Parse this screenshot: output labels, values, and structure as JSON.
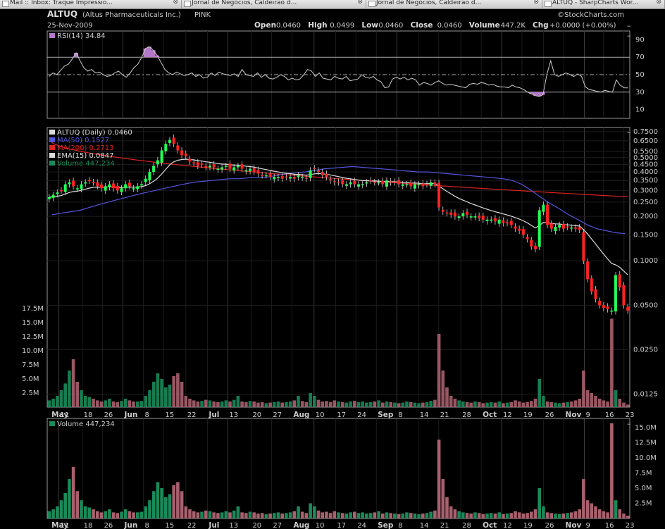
{
  "browser": {
    "tabs": [
      {
        "label": "Mail :: Inbox: Traque Impressio...",
        "x": 0,
        "w": 258
      },
      {
        "label": "Jornal de Negócios, Caldeirão d...",
        "x": 258,
        "w": 262
      },
      {
        "label": "Jornal de Negócios, Caldeirão d...",
        "x": 520,
        "w": 250
      },
      {
        "label": "ALTUQ - SharpCharts Wor...",
        "x": 770,
        "w": 174
      }
    ]
  },
  "header": {
    "symbol": "ALTUQ",
    "company": "(Altus Pharmaceuticals Inc.)",
    "exchange": "PINK",
    "date": "25-Nov-2009",
    "brand": "©StockCharts.com",
    "quote": [
      {
        "label": "Open",
        "value": "0.0460"
      },
      {
        "label": "High",
        "value": "0.0499"
      },
      {
        "label": "Low",
        "value": "0.0460"
      },
      {
        "label": "Close",
        "value": "0.0460"
      },
      {
        "label": "Volume",
        "value": "447.2K"
      },
      {
        "label": "Chg",
        "value": "+0.0000 (+0.00%)"
      }
    ]
  },
  "colors": {
    "up": "#22ff55",
    "down": "#ff2222",
    "vol_up": "#1a8a5a",
    "vol_down": "#a8606e",
    "ma50": "#5555dd",
    "ma200": "#dd2222",
    "ema": "#dddddd",
    "rsi": "#cccccc",
    "rsi_fill": "#b478c8",
    "grid": "#2a2a2a",
    "text": "#cccccc"
  },
  "chart_data": [
    {
      "type": "line",
      "title": "RSI(14) 34.84",
      "legend": "RSI(14) 34.84",
      "y_ticks": [
        90,
        70,
        50,
        30,
        10
      ],
      "ylim": [
        0,
        100
      ],
      "reference_lines": [
        70,
        50,
        30
      ],
      "series": [
        {
          "name": "RSI(14)",
          "values": [
            48,
            52,
            50,
            55,
            60,
            62,
            68,
            75,
            66,
            58,
            54,
            56,
            52,
            53,
            50,
            48,
            49,
            52,
            54,
            50,
            47,
            52,
            58,
            62,
            70,
            80,
            82,
            78,
            72,
            64,
            56,
            52,
            50,
            53,
            51,
            49,
            50,
            52,
            48,
            50,
            46,
            47,
            52,
            49,
            53,
            51,
            50,
            49,
            51,
            48,
            56,
            50,
            49,
            48,
            52,
            47,
            50,
            46,
            45,
            47,
            50,
            48,
            44,
            46,
            44,
            45,
            50,
            56,
            54,
            48,
            52,
            46,
            45,
            44,
            48,
            46,
            45,
            48,
            43,
            44,
            45,
            50,
            47,
            46,
            48,
            44,
            42,
            35,
            36,
            45,
            47,
            45,
            47,
            44,
            46,
            44,
            38,
            41,
            40,
            38,
            41,
            43,
            40,
            38,
            39,
            38,
            37,
            36,
            35,
            39,
            40,
            39,
            41,
            40,
            38,
            39,
            37,
            36,
            36,
            35,
            38,
            36,
            35,
            33,
            30,
            28,
            26,
            25,
            27,
            50,
            66,
            50,
            48,
            50,
            52,
            50,
            48,
            51,
            48,
            36,
            33,
            32,
            31,
            30,
            32,
            31,
            30,
            44,
            38,
            35,
            34.84
          ]
        }
      ]
    },
    {
      "type": "candlestick",
      "title": "ALTUQ (Daily) 0.0460",
      "legend": [
        {
          "label": "ALTUQ (Daily) 0.0460",
          "color": "#dddddd"
        },
        {
          "label": "MA(50) 0.1527",
          "color": "#5555dd"
        },
        {
          "label": "MA(200) 0.2713",
          "color": "#dd2222"
        },
        {
          "label": "EMA(15) 0.0847",
          "color": "#dddddd"
        },
        {
          "label": "Volume 447,234",
          "color": "#1a8a5a"
        }
      ],
      "y_scale": "log",
      "y_ticks": [
        "0.7500",
        "0.6500",
        "0.5500",
        "0.5000",
        "0.4500",
        "0.4000",
        "0.3500",
        "0.3000",
        "0.2500",
        "0.2000",
        "0.1500",
        "0.1000",
        "0.0500",
        "0.0250",
        "0.0125"
      ],
      "x_labels": [
        "May",
        "11",
        "18",
        "26",
        "Jun",
        "8",
        "15",
        "22",
        "Jul",
        "13",
        "20",
        "27",
        "Aug",
        "10",
        "17",
        "24",
        "Sep",
        "8",
        "14",
        "21",
        "28",
        "Oct",
        "12",
        "19",
        "26",
        "Nov",
        "9",
        "16",
        "23"
      ],
      "volume_overlay_ticks": [
        "17.5M",
        "15.0M",
        "12.5M",
        "10.0M",
        "7.5M",
        "5.0M",
        "2.5M"
      ],
      "close": [
        0.27,
        0.28,
        0.29,
        0.3,
        0.33,
        0.34,
        0.32,
        0.31,
        0.33,
        0.34,
        0.35,
        0.34,
        0.32,
        0.31,
        0.32,
        0.33,
        0.31,
        0.3,
        0.31,
        0.33,
        0.32,
        0.31,
        0.32,
        0.33,
        0.36,
        0.4,
        0.44,
        0.48,
        0.56,
        0.62,
        0.66,
        0.62,
        0.56,
        0.52,
        0.51,
        0.47,
        0.46,
        0.44,
        0.45,
        0.43,
        0.44,
        0.43,
        0.42,
        0.43,
        0.44,
        0.42,
        0.43,
        0.44,
        0.42,
        0.41,
        0.42,
        0.4,
        0.39,
        0.38,
        0.38,
        0.37,
        0.37,
        0.37,
        0.36,
        0.37,
        0.37,
        0.36,
        0.38,
        0.37,
        0.36,
        0.41,
        0.42,
        0.4,
        0.38,
        0.37,
        0.35,
        0.34,
        0.34,
        0.33,
        0.33,
        0.34,
        0.33,
        0.33,
        0.33,
        0.34,
        0.35,
        0.34,
        0.34,
        0.33,
        0.35,
        0.34,
        0.34,
        0.33,
        0.33,
        0.33,
        0.32,
        0.33,
        0.33,
        0.32,
        0.33,
        0.34,
        0.33,
        0.23,
        0.215,
        0.21,
        0.205,
        0.2,
        0.2,
        0.21,
        0.205,
        0.2,
        0.2,
        0.195,
        0.19,
        0.19,
        0.19,
        0.185,
        0.19,
        0.18,
        0.18,
        0.175,
        0.165,
        0.16,
        0.15,
        0.14,
        0.125,
        0.12,
        0.22,
        0.24,
        0.175,
        0.165,
        0.17,
        0.175,
        0.165,
        0.17,
        0.168,
        0.165,
        0.162,
        0.1,
        0.075,
        0.062,
        0.055,
        0.05,
        0.048,
        0.047,
        0.046,
        0.08,
        0.066,
        0.05,
        0.046
      ],
      "volume_M": [
        1.2,
        1.5,
        2.0,
        3.0,
        4.2,
        6.5,
        8.5,
        4.5,
        3.0,
        2.0,
        1.8,
        1.5,
        1.2,
        1.0,
        1.2,
        1.5,
        1.0,
        0.9,
        1.1,
        1.5,
        1.2,
        1.0,
        1.0,
        1.1,
        2.0,
        3.0,
        4.5,
        6.0,
        5.0,
        3.5,
        4.0,
        5.5,
        6.0,
        4.5,
        2.0,
        1.5,
        1.2,
        1.0,
        1.1,
        1.3,
        1.2,
        1.0,
        0.9,
        1.0,
        1.2,
        1.0,
        1.3,
        2.0,
        1.0,
        0.9,
        1.1,
        1.0,
        0.8,
        0.9,
        0.7,
        0.8,
        0.9,
        1.0,
        0.8,
        0.9,
        1.0,
        1.2,
        2.0,
        1.1,
        0.9,
        2.5,
        2.0,
        1.3,
        1.0,
        1.1,
        0.9,
        1.2,
        1.0,
        0.9,
        0.8,
        1.0,
        1.1,
        0.9,
        1.0,
        0.8,
        0.9,
        1.0,
        1.2,
        0.8,
        1.0,
        0.9,
        0.8,
        0.7,
        0.8,
        1.0,
        0.9,
        0.8,
        0.7,
        0.8,
        0.9,
        1.1,
        1.3,
        13.0,
        6.5,
        3.5,
        2.0,
        1.5,
        1.2,
        1.0,
        0.9,
        0.8,
        1.0,
        0.9,
        0.7,
        0.8,
        0.9,
        0.8,
        1.0,
        0.7,
        0.8,
        0.9,
        1.2,
        1.0,
        0.8,
        0.9,
        1.1,
        1.5,
        5.0,
        2.0,
        1.0,
        0.9,
        0.8,
        0.7,
        0.8,
        0.9,
        1.0,
        1.2,
        1.5,
        6.5,
        3.0,
        2.5,
        2.0,
        1.5,
        1.2,
        1.0,
        15.7,
        3.0,
        1.5,
        0.8,
        0.45
      ],
      "ma50": [
        0.205,
        0.21,
        0.215,
        0.22,
        0.23,
        0.24,
        0.25,
        0.26,
        0.27,
        0.28,
        0.29,
        0.3,
        0.31,
        0.32,
        0.33,
        0.34,
        0.345,
        0.35,
        0.355,
        0.36,
        0.36,
        0.365,
        0.365,
        0.37,
        0.38,
        0.39,
        0.395,
        0.4,
        0.41,
        0.42,
        0.425,
        0.43,
        0.435,
        0.43,
        0.425,
        0.42,
        0.415,
        0.41,
        0.405,
        0.4,
        0.4,
        0.395,
        0.39,
        0.385,
        0.38,
        0.375,
        0.37,
        0.365,
        0.36,
        0.35,
        0.33,
        0.3,
        0.27,
        0.245,
        0.225,
        0.205,
        0.19,
        0.175,
        0.165,
        0.16,
        0.155,
        0.1527
      ]
    },
    {
      "type": "bar",
      "title": "Volume 447,234",
      "legend": "Volume 447,234",
      "y_ticks": [
        "15.0M",
        "12.5M",
        "10.0M",
        "7.5M",
        "5.0M",
        "2.5M"
      ],
      "ylim": [
        0,
        16.5
      ],
      "x_labels": [
        "May",
        "11",
        "18",
        "26",
        "Jun",
        "8",
        "15",
        "22",
        "Jul",
        "13",
        "20",
        "27",
        "Aug",
        "10",
        "17",
        "24",
        "Sep",
        "8",
        "14",
        "21",
        "28",
        "Oct",
        "12",
        "19",
        "26",
        "Nov",
        "9",
        "16",
        "23"
      ]
    }
  ]
}
